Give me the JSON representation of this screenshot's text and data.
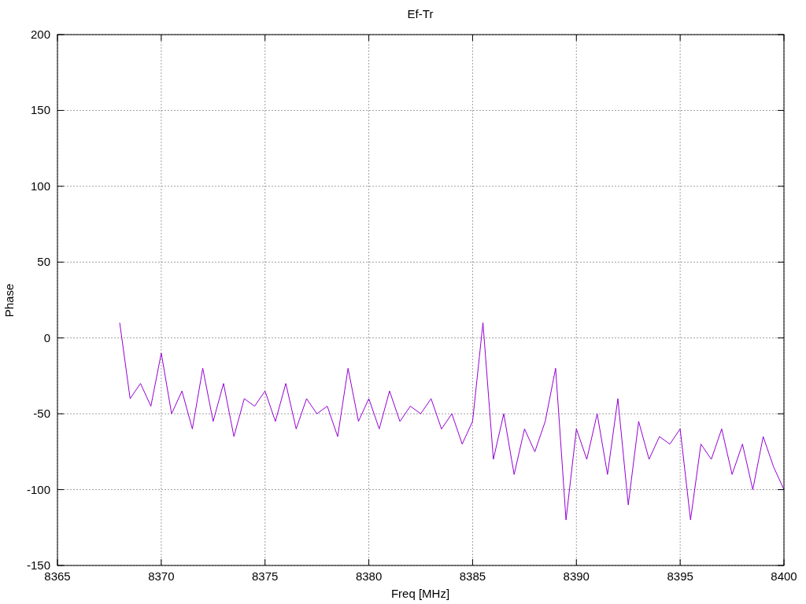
{
  "chart_data": {
    "type": "line",
    "title": "Ef-Tr",
    "xlabel": "Freq [MHz]",
    "ylabel": "Phase",
    "xlim": [
      8365,
      8400
    ],
    "ylim": [
      -150,
      200
    ],
    "xticks": [
      8365,
      8370,
      8375,
      8380,
      8385,
      8390,
      8395,
      8400
    ],
    "yticks": [
      -150,
      -100,
      -50,
      0,
      50,
      100,
      150,
      200
    ],
    "x": [
      8368,
      8368.5,
      8369,
      8369.5,
      8370,
      8370.5,
      8371,
      8371.5,
      8372,
      8372.5,
      8373,
      8373.5,
      8374,
      8374.5,
      8375,
      8375.5,
      8376,
      8376.5,
      8377,
      8377.5,
      8378,
      8378.5,
      8379,
      8379.5,
      8380,
      8380.5,
      8381,
      8381.5,
      8382,
      8382.5,
      8383,
      8383.5,
      8384,
      8384.5,
      8385,
      8385.5,
      8386,
      8386.5,
      8387,
      8387.5,
      8388,
      8388.5,
      8389,
      8389.5,
      8390,
      8390.5,
      8391,
      8391.5,
      8392,
      8392.5,
      8393,
      8393.5,
      8394,
      8394.5,
      8395,
      8395.5,
      8396,
      8396.5,
      8397,
      8397.5,
      8398,
      8398.5,
      8399,
      8399.5,
      8400
    ],
    "grid": true,
    "series": [
      {
        "color": "#9400d3",
        "values": [
          10,
          -40,
          -30,
          -45,
          -10,
          -50,
          -35,
          -60,
          -20,
          -55,
          -30,
          -65,
          -40,
          -45,
          -35,
          -55,
          -30,
          -60,
          -40,
          -50,
          -45,
          -65,
          -20,
          -55,
          -40,
          -60,
          -35,
          -55,
          -45,
          -50,
          -40,
          -60,
          -50,
          -70,
          -55,
          10,
          -80,
          -50,
          -90,
          -60,
          -75,
          -55,
          -20,
          -120,
          -60,
          -80,
          -50,
          -90,
          -40,
          -110,
          -55,
          -80,
          -65,
          -70,
          -60,
          -120,
          -70,
          -80,
          -60,
          -90,
          -70,
          -100,
          -65,
          -85,
          -100
        ]
      }
    ]
  }
}
